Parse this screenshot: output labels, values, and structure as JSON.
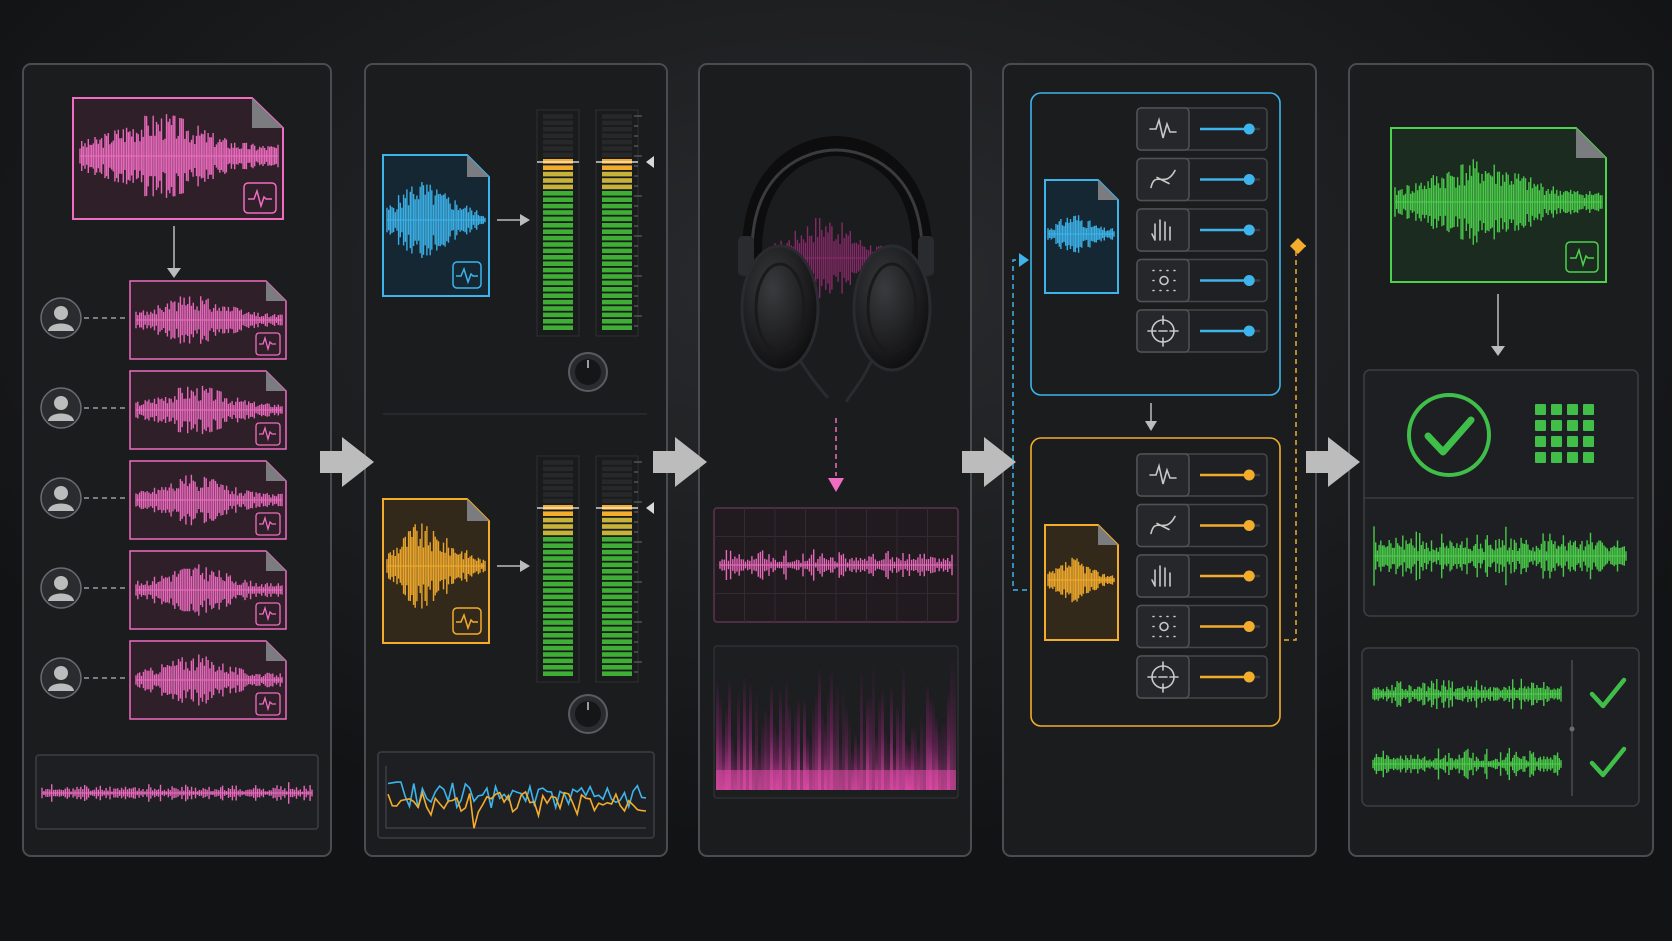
{
  "colors": {
    "background": "#121314",
    "panel": "#1b1c1e",
    "pink": "#f06dc2",
    "blue": "#3db4ec",
    "amber": "#f3ac2c",
    "green": "#4cd24c",
    "flow_arrow": "#bcbcbc"
  },
  "stages": [
    {
      "id": "split",
      "icons": [
        "audio-file-icon",
        "person-icon"
      ],
      "speaker_tracks": 5
    },
    {
      "id": "level",
      "icons": [
        "audio-file-icon",
        "level-meter",
        "gain-knob-icon"
      ],
      "channels": 2
    },
    {
      "id": "listen",
      "icons": [
        "headphones-icon",
        "waveform",
        "spectrogram"
      ]
    },
    {
      "id": "process",
      "icons": [
        "waveform-icon",
        "curve-icon",
        "hand-tool-icon",
        "grid-dots-icon",
        "crosshair-icon"
      ],
      "effects_per_chain": 5
    },
    {
      "id": "verify",
      "icons": [
        "check-circle-icon",
        "grid-icon",
        "checkmark-icon"
      ],
      "verified_tracks": 2
    }
  ],
  "processing": {
    "blue_chain_levels": [
      0.82,
      0.82,
      0.82,
      0.82,
      0.82
    ],
    "amber_chain_levels": [
      0.82,
      0.82,
      0.82,
      0.82,
      0.82
    ]
  }
}
